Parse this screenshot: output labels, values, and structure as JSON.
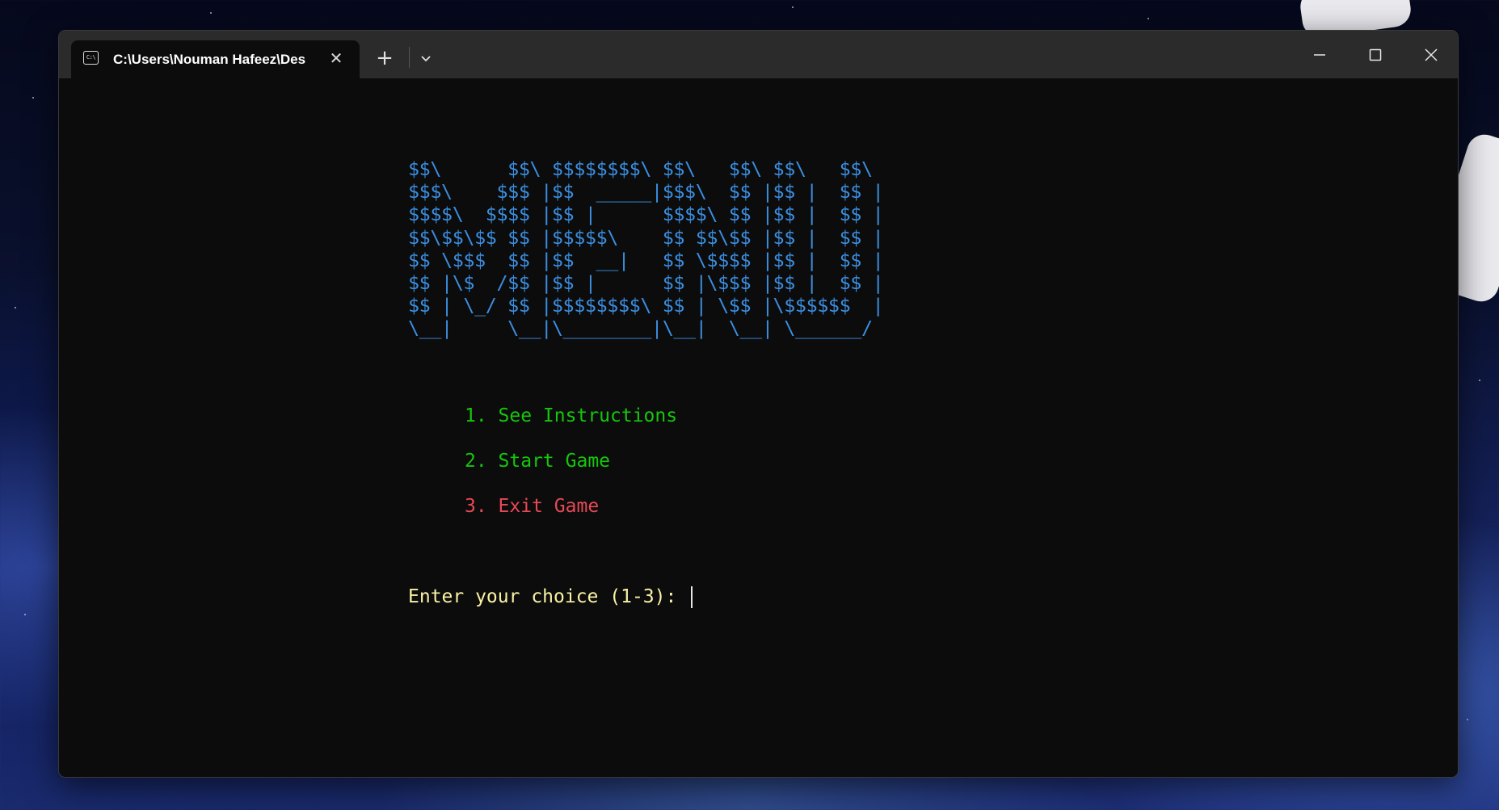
{
  "window": {
    "tab_title": "C:\\Users\\Nouman Hafeez\\Des",
    "tab_icon": "terminal-icon",
    "tab_icon_glyph": "C:\\",
    "tab_close_glyph": "✕",
    "new_tab_glyph": "+",
    "controls": [
      "minimize-icon",
      "maximize-icon",
      "close-icon"
    ]
  },
  "terminal": {
    "banner": "$$\\      $$\\ $$$$$$$$\\ $$\\   $$\\ $$\\   $$\\\n$$$\\    $$$ |$$  _____|$$$\\  $$ |$$ |  $$ |\n$$$$\\  $$$$ |$$ |      $$$$\\ $$ |$$ |  $$ |\n$$\\$$\\$$ $$ |$$$$$\\    $$ $$\\$$ |$$ |  $$ |\n$$ \\$$$  $$ |$$  __|   $$ \\$$$$ |$$ |  $$ |\n$$ |\\$  /$$ |$$ |      $$ |\\$$$ |$$ |  $$ |\n$$ | \\_/ $$ |$$$$$$$$\\ $$ | \\$$ |\\$$$$$$  |\n\\__|     \\__|\\________|\\__|  \\__| \\______/",
    "menu": [
      "1. See Instructions",
      "2. Start Game",
      "3. Exit Game"
    ],
    "prompt": "Enter your choice (1-3): ",
    "colors": {
      "banner": "#3b8ee0",
      "menu_ok": "#16c60c",
      "menu_exit": "#e74856",
      "prompt": "#f9f1a5",
      "background": "#0c0c0c"
    }
  }
}
